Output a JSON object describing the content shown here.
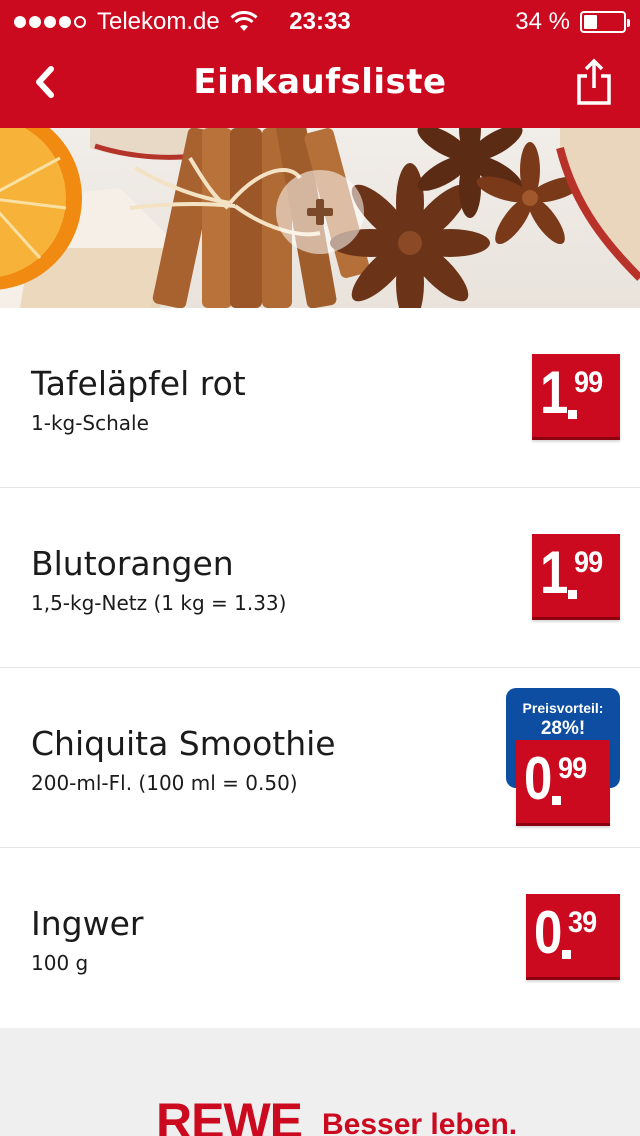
{
  "status_bar": {
    "carrier": "Telekom.de",
    "time": "23:33",
    "battery": "34 %",
    "battery_level": 0.34,
    "signal_bars": 4
  },
  "nav": {
    "title": "Einkaufsliste",
    "back_icon": "chevron-left-icon",
    "share_icon": "share-icon"
  },
  "hero": {
    "add_icon": "plus-icon"
  },
  "items": [
    {
      "name": "Tafeläpfel rot",
      "detail": "1-kg-Schale",
      "price_euro": "1",
      "price_cents": "99"
    },
    {
      "name": "Blutorangen",
      "detail": "1,5-kg-Netz (1 kg = 1.33)",
      "price_euro": "1",
      "price_cents": "99"
    },
    {
      "name": "Chiquita Smoothie",
      "detail": "200-ml-Fl. (100 ml = 0.50)",
      "price_euro": "0",
      "price_cents": "99",
      "badge_label": "Preisvorteil:",
      "badge_value": "28%!"
    },
    {
      "name": "Ingwer",
      "detail": "100 g",
      "price_euro": "0",
      "price_cents": "39"
    }
  ],
  "footer": {
    "brand": "REWE",
    "slogan": "Besser leben."
  },
  "colors": {
    "brand_red": "#cc0a1f",
    "badge_blue": "#0d4ea2"
  }
}
